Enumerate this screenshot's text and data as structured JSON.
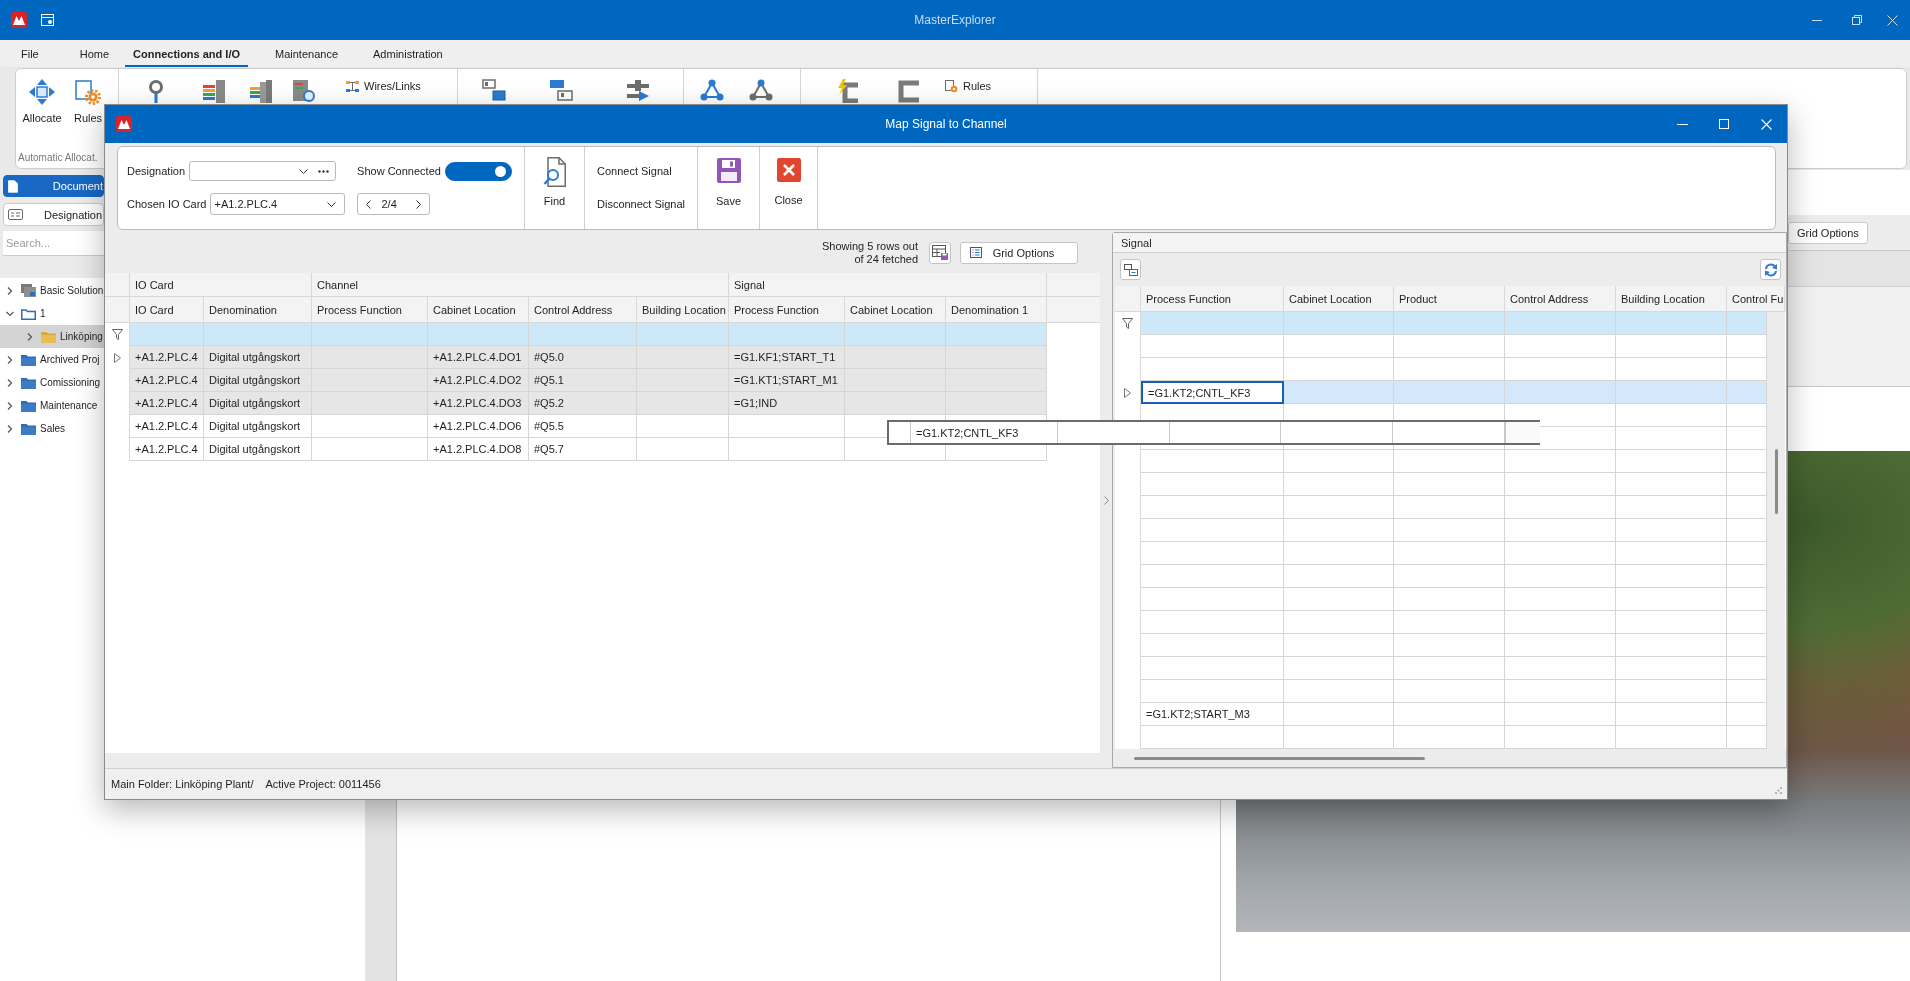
{
  "window": {
    "title": "MasterExplorer"
  },
  "menu": [
    {
      "label": "File",
      "selected": false
    },
    {
      "label": "Home",
      "selected": false
    },
    {
      "label": "Connections and I/O",
      "selected": true
    },
    {
      "label": "Maintenance",
      "selected": false
    },
    {
      "label": "Administration",
      "selected": false
    }
  ],
  "ribbon": {
    "allocation_group": {
      "label": "Automatic Allocat.",
      "buttons": [
        "Allocate",
        "Rules"
      ]
    },
    "links_button": "Wires/Links",
    "rules_button": "Rules"
  },
  "side_panel": {
    "buttons": [
      {
        "label": "Document",
        "selected": true
      },
      {
        "label": "Designation",
        "selected": false
      }
    ],
    "search": {
      "placeholder": "Search..."
    },
    "tree": [
      {
        "label": "Basic Solution",
        "kind": "solution",
        "expanded": false,
        "selected": false
      },
      {
        "label": "1",
        "kind": "project",
        "expanded": true,
        "selected": false,
        "children": [
          {
            "label": "Linköping",
            "kind": "plant",
            "expanded": false,
            "selected": true
          }
        ]
      },
      {
        "label": "Archived Proj",
        "kind": "group",
        "expanded": false,
        "selected": false
      },
      {
        "label": "Comissioning",
        "kind": "group",
        "expanded": false,
        "selected": false
      },
      {
        "label": "Maintenance",
        "kind": "group",
        "expanded": false,
        "selected": false
      },
      {
        "label": "Sales",
        "kind": "group",
        "expanded": false,
        "selected": false
      }
    ]
  },
  "main_panel": {
    "grid_options_button": "Grid Options"
  },
  "dialog": {
    "title": "Map Signal to Channel",
    "toolbar": {
      "designation": {
        "label": "Designation"
      },
      "show_connected": {
        "label": "Show Connected",
        "on": true
      },
      "io_card": {
        "label": "Chosen IO Card",
        "value": "+A1.2.PLC.4"
      },
      "page_indicator": "2/4",
      "buttons": [
        {
          "kind": "find",
          "label": "Find"
        },
        {
          "kind": "stack",
          "labels": [
            "Connect Signal",
            "Disconnect Signal"
          ]
        },
        {
          "kind": "save",
          "label": "Save"
        },
        {
          "kind": "close",
          "label": "Close"
        }
      ]
    },
    "channel_grid": {
      "summary": [
        "Showing 5 rows out",
        "of 24 fetched"
      ],
      "grid_options_button": "Grid Options",
      "column_groups": [
        {
          "label": "IO Card",
          "columns": [
            "IO Card",
            "Denomination"
          ]
        },
        {
          "label": "Channel",
          "columns": [
            "Process Function",
            "Cabinet Location",
            "Control Address",
            "Building Location"
          ]
        },
        {
          "label": "Signal",
          "columns": [
            "Process Function",
            "Cabinet Location",
            "Denomination 1"
          ]
        }
      ],
      "rows": [
        {
          "current": true,
          "connected": true,
          "cells": [
            "+A1.2.PLC.4",
            "Digital utgångskort",
            null,
            "+A1.2.PLC.4.DO1",
            "#Q5.0",
            null,
            "=G1.KF1;START_T1"
          ]
        },
        {
          "current": false,
          "connected": true,
          "cells": [
            "+A1.2.PLC.4",
            "Digital utgångskort",
            null,
            "+A1.2.PLC.4.DO2",
            "#Q5.1",
            null,
            "=G1.KT1;START_M1"
          ]
        },
        {
          "current": false,
          "connected": true,
          "cells": [
            "+A1.2.PLC.4",
            "Digital utgångskort",
            null,
            "+A1.2.PLC.4.DO3",
            "#Q5.2",
            null,
            "=G1;IND"
          ]
        },
        {
          "current": false,
          "connected": false,
          "cells": [
            "+A1.2.PLC.4",
            "Digital utgångskort",
            null,
            "+A1.2.PLC.4.DO6",
            "#Q5.5"
          ]
        },
        {
          "current": false,
          "connected": false,
          "cells": [
            "+A1.2.PLC.4",
            "Digital utgångskort",
            null,
            "+A1.2.PLC.4.DO8",
            "#Q5.7"
          ]
        }
      ]
    },
    "signal_panel": {
      "title": "Signal",
      "columns": [
        "Process Function",
        "Cabinet Location",
        "Product",
        "Control Address",
        "Building Location",
        "Control Fu"
      ],
      "rows": [
        {
          "selected": false
        },
        {
          "selected": false
        },
        {
          "selected": true,
          "cells": [
            "=G1.KT2;CNTL_KF3"
          ]
        },
        {
          "selected": false
        },
        {
          "selected": false
        },
        {
          "selected": false
        },
        {
          "selected": false
        },
        {
          "selected": false
        },
        {
          "selected": false
        },
        {
          "selected": false
        },
        {
          "selected": false
        },
        {
          "selected": false
        },
        {
          "selected": false
        },
        {
          "selected": false
        },
        {
          "selected": false
        },
        {
          "selected": false
        },
        {
          "selected": false,
          "cells": [
            "=G1.KT2;START_M3"
          ]
        },
        {
          "selected": false
        }
      ]
    },
    "drag_preview": {
      "cells": [
        "=G1.KT2;CNTL_KF3"
      ]
    },
    "status_bar": [
      "Main Folder: Linköping Plant/",
      "Active Project: 0011456"
    ]
  }
}
